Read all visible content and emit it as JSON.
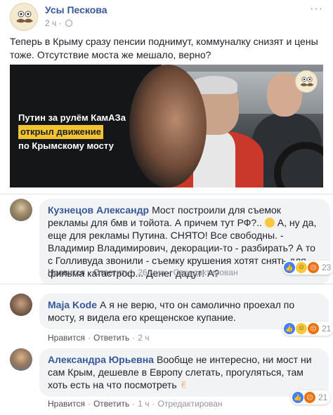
{
  "post": {
    "page_name": "Усы Пескова",
    "time": "2 ч",
    "text": "Теперь в Крыму сразу пенсии поднимут, коммуналку снизят и цены тоже. Отсутствие моста же мешало, верно?",
    "image": {
      "line1": "Путин за рулём КамАЗа",
      "line2": "открыл движение",
      "line3": "по Крымскому мосту"
    }
  },
  "comments": [
    {
      "author": "Кузнецов Александр",
      "text_before_emoji": "Мост построили для съемок рекламы для бмв и тойота. А причем тут РФ?..",
      "text_after_emoji": "А, ну да, еще для рекламы Путина. СНЯТО! Все свободны. - Владимир Владимирович, декорации-то - разбирать? А то с Голливуда звонили - съемку крушения хотят снять для фильма катастроф... Денег дадут! А?",
      "like_label": "Нравится",
      "reply_label": "Ответить",
      "time": "26 мин",
      "edited": "Отредактирован",
      "reactions": "23"
    },
    {
      "author": "Maja Kode",
      "text": "А я не верю, что он самолично проехал по мосту, я видела его крещенское купание.",
      "like_label": "Нравится",
      "reply_label": "Ответить",
      "time": "2 ч",
      "reactions": "21"
    },
    {
      "author": "Александра Юрьевна",
      "text": "Вообще не интересно, ни мост ни сам Крым, дешевле в Европу слетать, прогуляться, там хоть есть на что посмотреть",
      "like_label": "Нравится",
      "reply_label": "Ответить",
      "time": "1 ч",
      "edited": "Отредактирован",
      "reactions": "21"
    }
  ],
  "icons": {
    "globe": "globe-icon",
    "more": "more-icon",
    "like": "like-icon",
    "haha": "haha-icon",
    "angry": "angry-icon"
  },
  "colors": {
    "link": "#365899",
    "meta": "#90949c",
    "bubble": "#f2f3f5",
    "highlight": "#f1c232"
  }
}
